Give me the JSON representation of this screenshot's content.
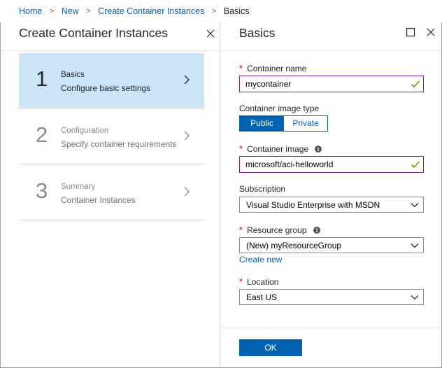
{
  "breadcrumb": {
    "items": [
      "Home",
      "New",
      "Create Container Instances"
    ],
    "current": "Basics",
    "separator": ">"
  },
  "left_blade": {
    "title": "Create Container Instances",
    "close_icon": "close-icon",
    "steps": [
      {
        "number": "1",
        "title": "Basics",
        "description": "Configure basic settings",
        "state": "active"
      },
      {
        "number": "2",
        "title": "Configuration",
        "description": "Specify container requirements",
        "state": "inactive"
      },
      {
        "number": "3",
        "title": "Summary",
        "description": "Container Instances",
        "state": "inactive"
      }
    ]
  },
  "right_blade": {
    "title": "Basics",
    "maximize_icon": "maximize-icon",
    "close_icon": "close-icon",
    "fields": {
      "container_name": {
        "label": "Container name",
        "required": true,
        "value": "mycontainer",
        "valid": true
      },
      "image_type": {
        "label": "Container image type",
        "options": [
          "Public",
          "Private"
        ],
        "selected": "Public"
      },
      "container_image": {
        "label": "Container image",
        "required": true,
        "value": "microsoft/aci-helloworld",
        "valid": true,
        "info": true
      },
      "subscription": {
        "label": "Subscription",
        "value": "Visual Studio Enterprise with MSDN"
      },
      "resource_group": {
        "label": "Resource group",
        "required": true,
        "value": "(New) myResourceGroup",
        "info": true,
        "link": "Create new"
      },
      "location": {
        "label": "Location",
        "required": true,
        "value": "East US"
      }
    },
    "ok_label": "OK"
  },
  "colors": {
    "accent": "#0063b1",
    "active_step_bg": "#cce4f7",
    "required_star": "#c00000",
    "valid_check": "#57a300",
    "input_focus_border": "#7a1d96"
  }
}
